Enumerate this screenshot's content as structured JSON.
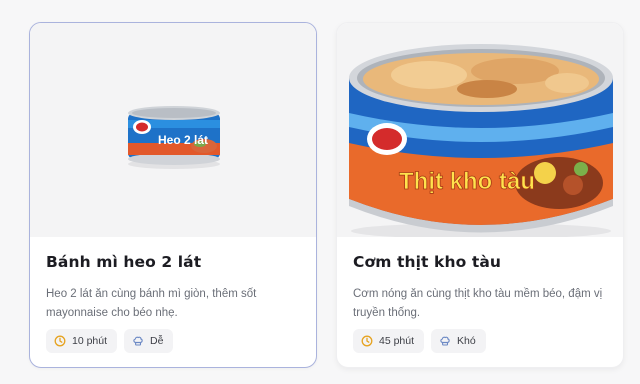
{
  "cards": [
    {
      "title": "Bánh mì heo 2 lát",
      "description": "Heo 2 lát ăn cùng bánh mì giòn, thêm sốt mayonnaise cho béo nhẹ.",
      "image_label": "Heo 2 lát",
      "time": "10 phút",
      "difficulty": "Dễ",
      "time_icon": "clock-icon",
      "difficulty_icon": "chef-hat-icon"
    },
    {
      "title": "Cơm thịt kho tàu",
      "description": "Cơm nóng ăn cùng thịt kho tàu mềm béo, đậm vị truyền thống.",
      "image_label": "Thịt kho tàu",
      "time": "45 phút",
      "difficulty": "Khó",
      "time_icon": "clock-icon",
      "difficulty_icon": "chef-hat-icon"
    }
  ],
  "colors": {
    "selected_border": "#aab3dd",
    "clock_icon": "#e6a321",
    "chef_icon": "#6b88c4"
  }
}
